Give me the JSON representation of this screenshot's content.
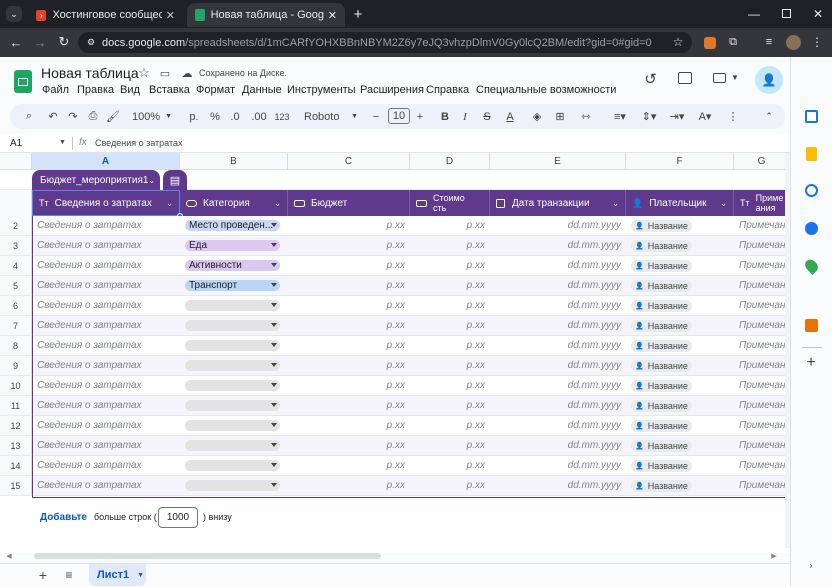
{
  "browser": {
    "tabs": [
      {
        "title": "Хостинговое сообщество «Tim"
      },
      {
        "title": "Новая таблица - Google Табли"
      }
    ],
    "url_host": "docs.google.com",
    "url_path": "/spreadsheets/d/1mCARfYOHXBBnNBYM2Z6y7eJQ3vhzpDlmV0Gy0lcQ2BM/edit?gid=0#gid=0"
  },
  "doc": {
    "title": "Новая таблица",
    "saved_status": "Сохранено на Диске.",
    "menu": [
      "Файл",
      "Правка",
      "Вид",
      "Вставка",
      "Формат",
      "Данные",
      "Инструменты",
      "Расширения",
      "Справка",
      "Специальные возможности"
    ]
  },
  "toolbar": {
    "zoom": "100%",
    "currency": "р.",
    "percent": "%",
    "dec_decrease": ".0",
    "dec_increase": ".00",
    "number_format": "123",
    "font": "Roboto",
    "font_size": "10"
  },
  "formula_bar": {
    "cell_ref": "A1",
    "fx": "fx",
    "content": "Сведения о затратах"
  },
  "columns": [
    "A",
    "B",
    "C",
    "D",
    "E",
    "F",
    "G"
  ],
  "table": {
    "name": "Бюджет_мероприятия1",
    "headers": [
      {
        "type": "Тт",
        "label": "Сведения о затратах"
      },
      {
        "type": "chip",
        "label": "Категория"
      },
      {
        "type": "money",
        "label": "Бюджет"
      },
      {
        "type": "money",
        "label": "Стоимо\nсть"
      },
      {
        "type": "date",
        "label": "Дата транзакции"
      },
      {
        "type": "person",
        "label": "Плательщик"
      },
      {
        "type": "Тт",
        "label": "Приме\nания"
      }
    ],
    "row_numbers": [
      "2",
      "3",
      "4",
      "5",
      "6",
      "7",
      "8",
      "9",
      "10",
      "11",
      "12",
      "13",
      "14",
      "15"
    ],
    "placeholder_text": "Сведения о затратах",
    "placeholder_money": "р.хх",
    "placeholder_date": "dd.mm.yyyy",
    "placeholder_person": "Название",
    "placeholder_notes": "Примечани",
    "categories": [
      {
        "label": "Место проведен...",
        "color": "#c7d7f5"
      },
      {
        "label": "Еда",
        "color": "#dcc9f3"
      },
      {
        "label": "Активности",
        "color": "#d9c8f0"
      },
      {
        "label": "Транспорт",
        "color": "#b9d6f7"
      }
    ],
    "empty_chip_color": "#e3e3e3"
  },
  "add_rows": {
    "link": "Добавьте",
    "text_before": "больше строк (",
    "count": "1000",
    "text_after": ") внизу"
  },
  "sheet_tab": "Лист1"
}
